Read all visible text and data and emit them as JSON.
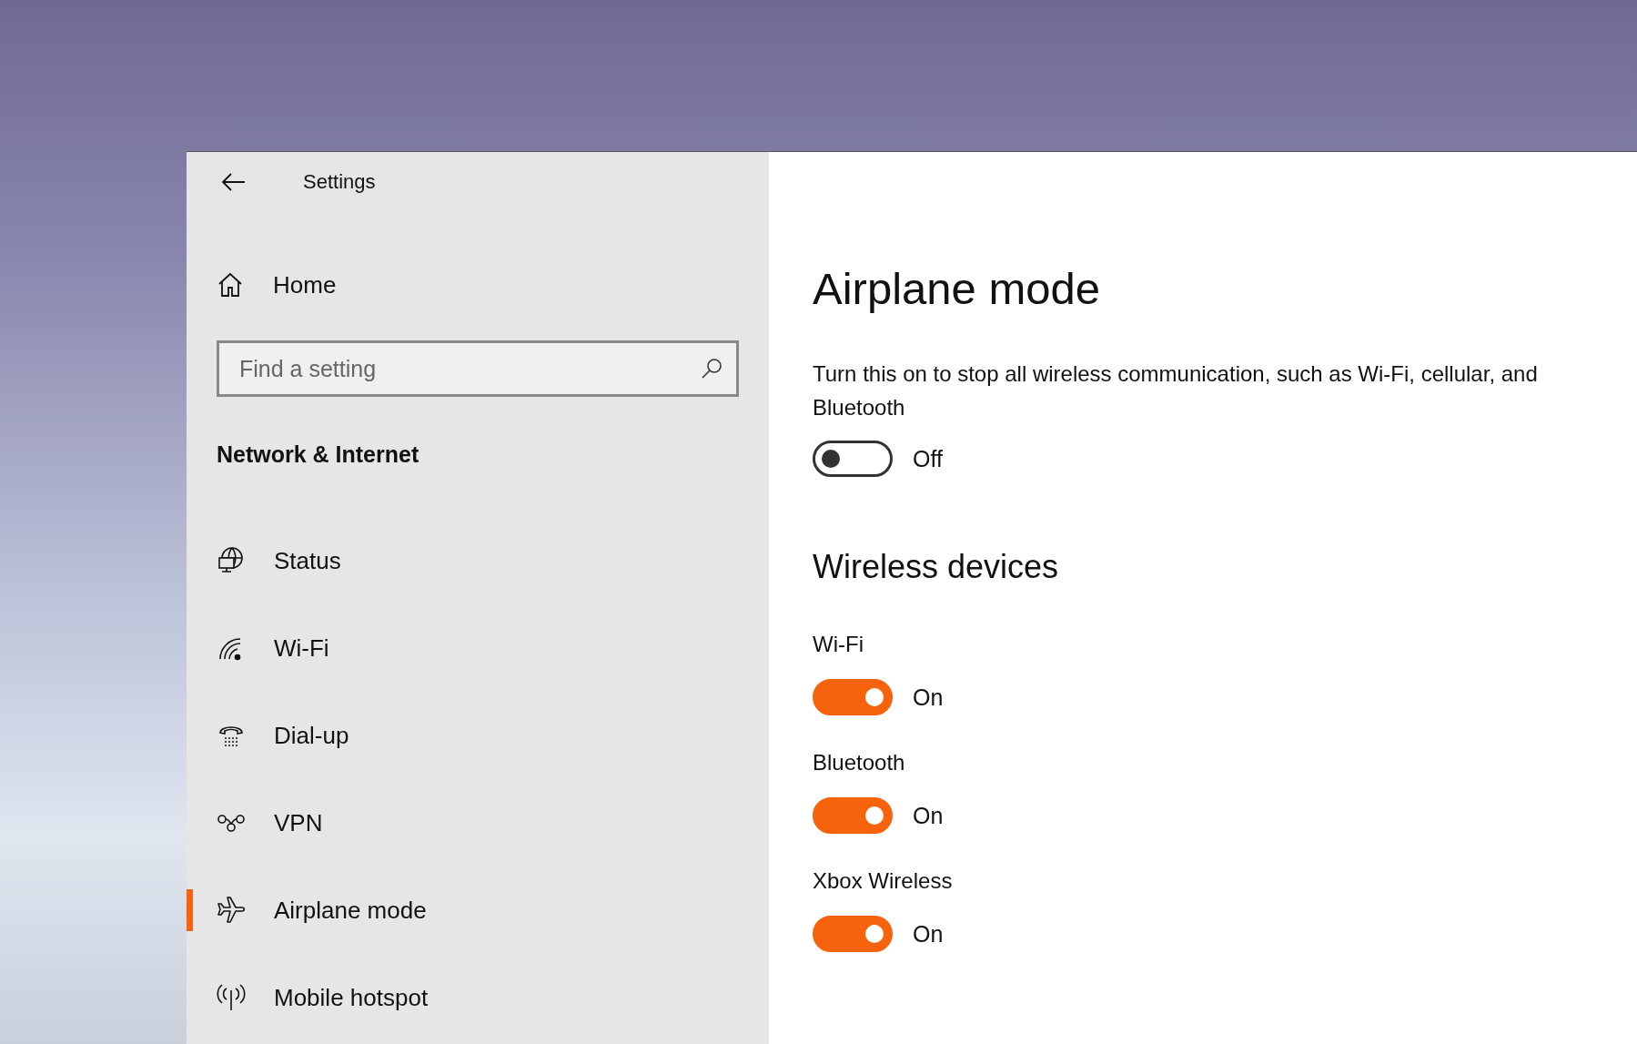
{
  "window": {
    "title": "Settings"
  },
  "sidebar": {
    "home": "Home",
    "search": {
      "placeholder": "Find a setting"
    },
    "section": "Network & Internet",
    "items": [
      {
        "label": "Status",
        "kind": "status",
        "selected": false
      },
      {
        "label": "Wi-Fi",
        "kind": "wifi",
        "selected": false
      },
      {
        "label": "Dial-up",
        "kind": "dialup",
        "selected": false
      },
      {
        "label": "VPN",
        "kind": "vpn",
        "selected": false
      },
      {
        "label": "Airplane mode",
        "kind": "airplane",
        "selected": true
      },
      {
        "label": "Mobile hotspot",
        "kind": "hotspot",
        "selected": false
      }
    ]
  },
  "page": {
    "title": "Airplane mode",
    "description": "Turn this on to stop all wireless communication, such as Wi-Fi, cellular, and Bluetooth",
    "toggle": {
      "on": false,
      "state_label": "Off"
    },
    "section_title": "Wireless devices",
    "devices": [
      {
        "label": "Wi-Fi",
        "on": true,
        "state_label": "On"
      },
      {
        "label": "Bluetooth",
        "on": true,
        "state_label": "On"
      },
      {
        "label": "Xbox Wireless",
        "on": true,
        "state_label": "On"
      }
    ]
  }
}
